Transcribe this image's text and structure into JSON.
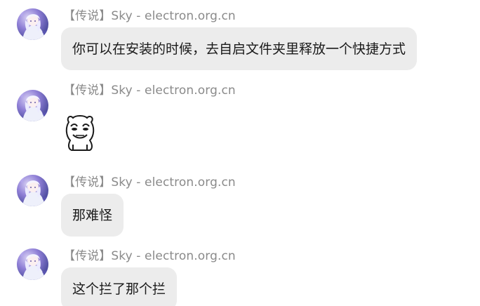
{
  "messages": [
    {
      "sender": "【传说】Sky - electron.org.cn",
      "type": "text",
      "text": "你可以在安装的时候，去自启文件夹里释放一个快捷方式"
    },
    {
      "sender": "【传说】Sky - electron.org.cn",
      "type": "sticker",
      "sticker_icon": "meme-bear-sticker-icon"
    },
    {
      "sender": "【传说】Sky - electron.org.cn",
      "type": "text",
      "text": "那难怪"
    },
    {
      "sender": "【传说】Sky - electron.org.cn",
      "type": "text",
      "text": "这个拦了那个拦"
    }
  ],
  "colors": {
    "bubble_bg": "#ececec",
    "sender_text": "#8a8a8a",
    "message_text": "#1a1a1a",
    "page_bg": "#ffffff"
  }
}
